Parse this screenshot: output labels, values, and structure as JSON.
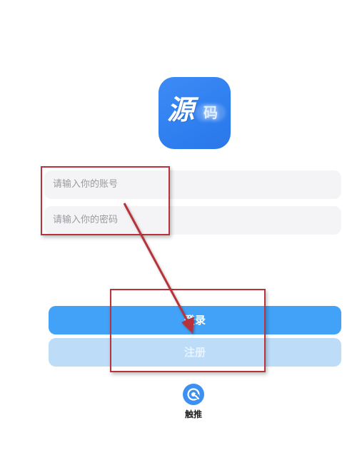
{
  "logo": {
    "main_char": "源",
    "sub_text": "码",
    "color": "#2f7ff0"
  },
  "form": {
    "account_placeholder": "请输入你的账号",
    "password_placeholder": "请输入你的密码"
  },
  "buttons": {
    "login_label": "登录",
    "register_label": "注册",
    "login_color": "#41a2f7",
    "register_color": "#bcdcf8"
  },
  "touch_push": {
    "icon": "touch-push-icon",
    "label": "触推"
  },
  "annotation": {
    "color": "#b8333a"
  }
}
